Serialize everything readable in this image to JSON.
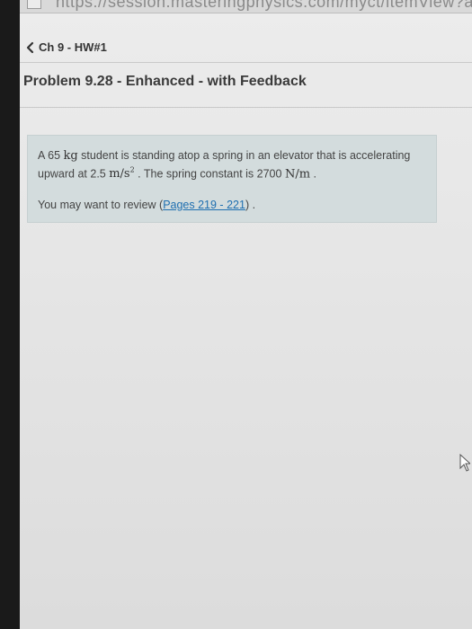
{
  "browser": {
    "url_text": "https://session.masteringphysics.com/myct/itemView?assignm"
  },
  "breadcrumb": {
    "label": "Ch 9 - HW#1"
  },
  "problem": {
    "title": "Problem 9.28 - Enhanced - with Feedback",
    "statement": {
      "text1": "A 65 ",
      "unit_kg": "kg",
      "text2": " student is standing atop a spring in an elevator that is accelerating upward at 2.5 ",
      "unit_accel": "m/s",
      "unit_accel_exp": "2",
      "text3": " . The spring constant is 2700 ",
      "unit_spring": "N/m",
      "text4": " ."
    },
    "review": {
      "prefix": "You may want to review (",
      "link_label": "Pages 219 - 221",
      "suffix": ") ."
    }
  },
  "colors": {
    "problem_box_bg": "#d3dcdd",
    "link": "#1f6fb0",
    "page_bg": "#e8e8e8"
  }
}
